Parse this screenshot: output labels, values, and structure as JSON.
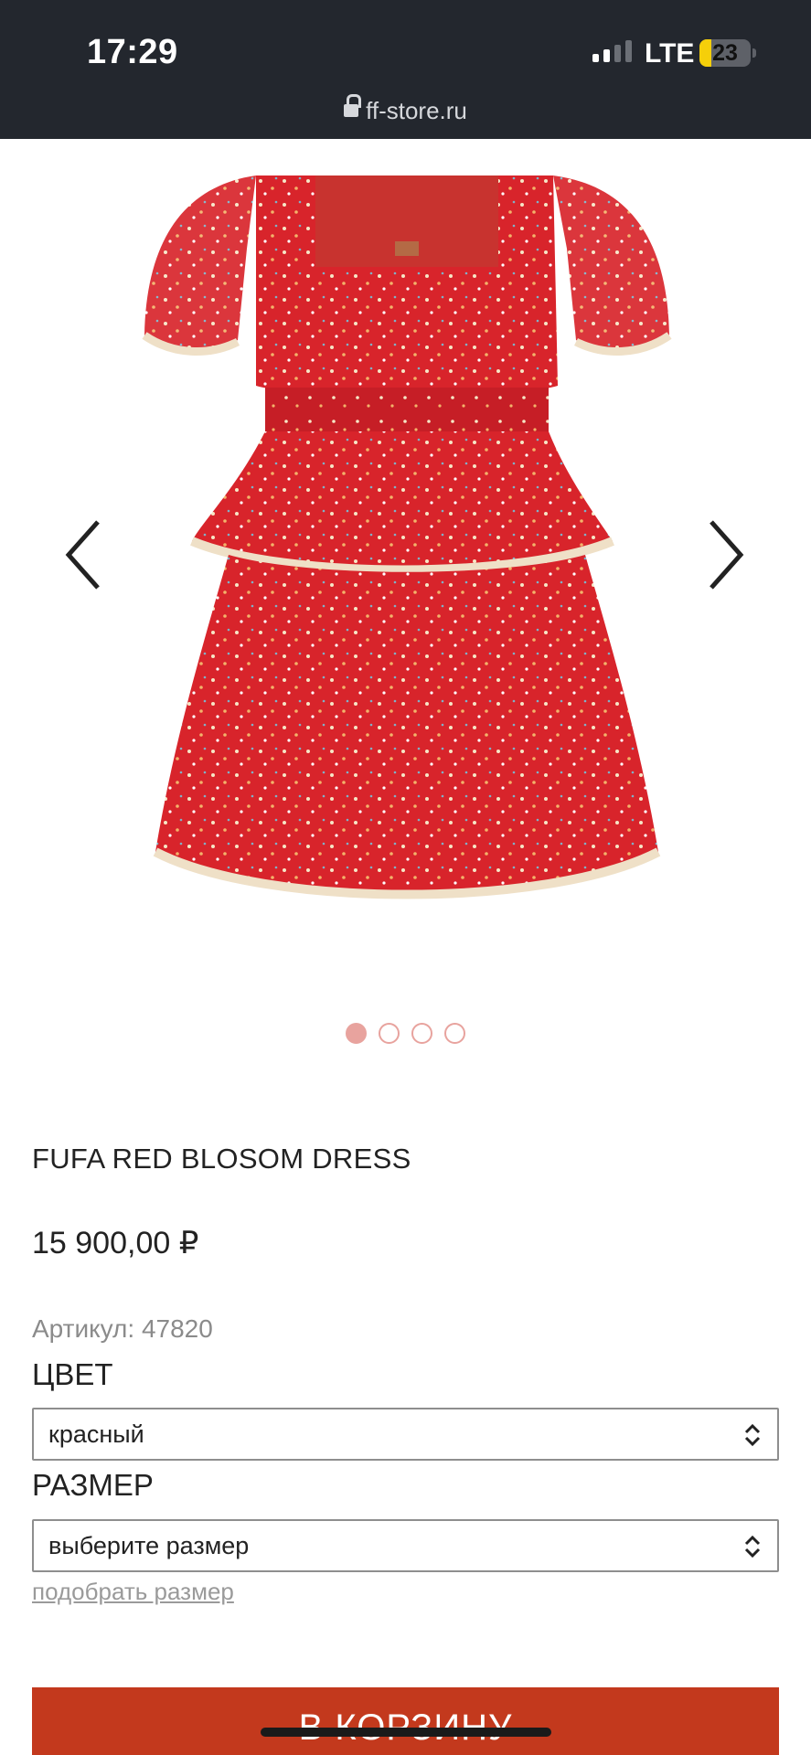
{
  "status_bar": {
    "time": "17:29",
    "network": "LTE",
    "battery": "23",
    "battery_level": 0.23
  },
  "browser": {
    "url": "ff-store.ru"
  },
  "gallery": {
    "image": "red-floral-dress",
    "prev_icon": "chevron-left-icon",
    "next_icon": "chevron-right-icon",
    "slide_count": 4,
    "active_slide": 1
  },
  "product": {
    "title": "FUFA RED BLOSOM DRESS",
    "price": "15 900,00 ₽",
    "sku": "Артикул: 47820",
    "color_label": "ЦВЕТ",
    "color_value": "красный",
    "size_label": "РАЗМЕР",
    "size_value": "выберите размер",
    "size_guide_link": "подобрать размер",
    "add_to_cart": "В КОРЗИНУ"
  },
  "colors": {
    "accent": "#c3391d",
    "dot": "#e8a39e",
    "status_bar": "#23272e"
  }
}
